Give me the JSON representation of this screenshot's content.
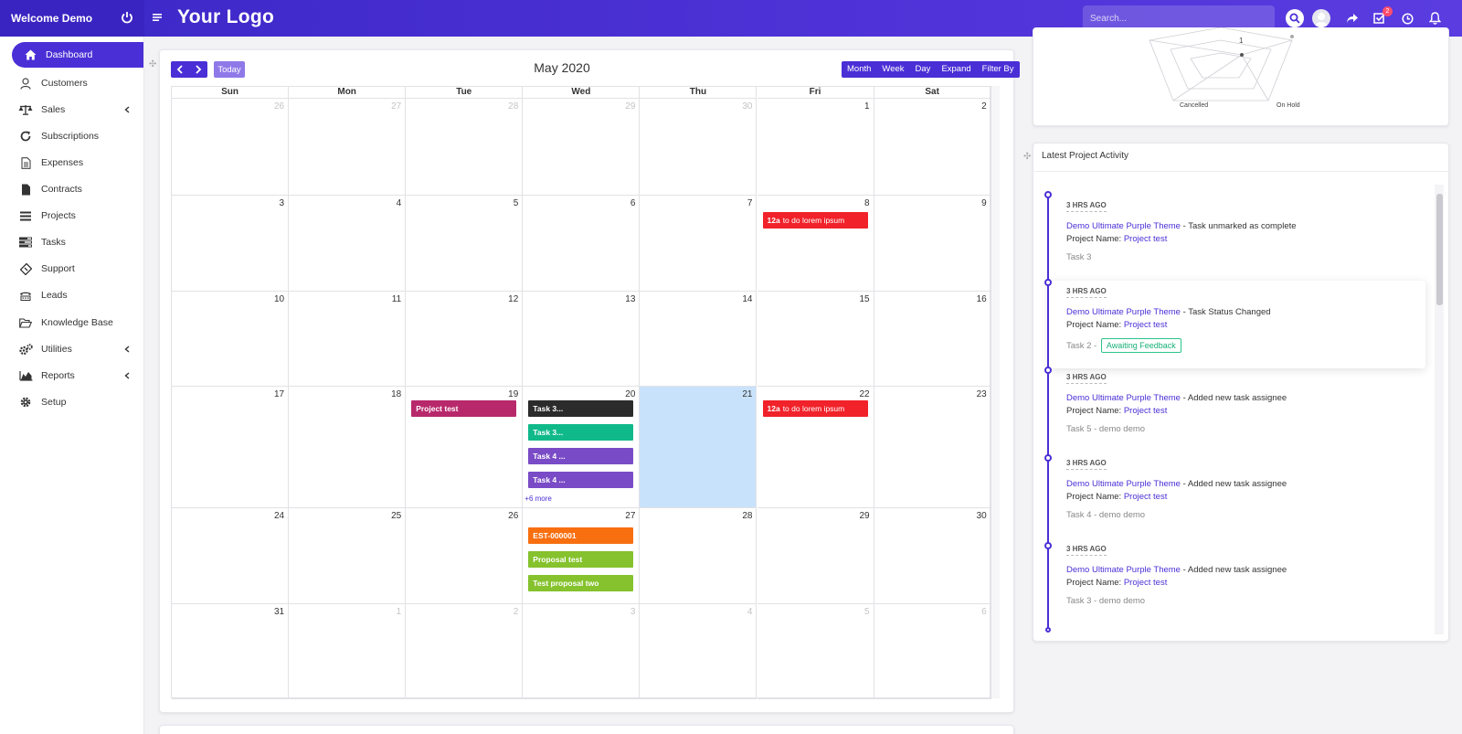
{
  "header": {
    "welcome": "Welcome Demo",
    "logo": "Your Logo",
    "search_placeholder": "Search...",
    "tasks_badge": "2"
  },
  "sidebar": {
    "items": [
      {
        "label": "Dashboard",
        "icon": "home-icon"
      },
      {
        "label": "Customers",
        "icon": "user-icon"
      },
      {
        "label": "Sales",
        "icon": "balance-scale-icon"
      },
      {
        "label": "Subscriptions",
        "icon": "refresh-icon"
      },
      {
        "label": "Expenses",
        "icon": "file-text-icon"
      },
      {
        "label": "Contracts",
        "icon": "file-icon"
      },
      {
        "label": "Projects",
        "icon": "bars-icon"
      },
      {
        "label": "Tasks",
        "icon": "tasks-icon"
      },
      {
        "label": "Support",
        "icon": "ticket-icon"
      },
      {
        "label": "Leads",
        "icon": "tty-icon"
      },
      {
        "label": "Knowledge Base",
        "icon": "folder-open-icon"
      },
      {
        "label": "Utilities",
        "icon": "cogs-icon"
      },
      {
        "label": "Reports",
        "icon": "area-chart-icon"
      },
      {
        "label": "Setup",
        "icon": "gear-icon"
      }
    ]
  },
  "calendar": {
    "title": "May 2020",
    "today_label": "Today",
    "views": [
      "Month",
      "Week",
      "Day",
      "Expand",
      "Filter By"
    ],
    "weekdays": [
      "Sun",
      "Mon",
      "Tue",
      "Wed",
      "Thu",
      "Fri",
      "Sat"
    ],
    "weeks": [
      [
        "26",
        "27",
        "28",
        "29",
        "30",
        "1",
        "2"
      ],
      [
        "3",
        "4",
        "5",
        "6",
        "7",
        "8",
        "9"
      ],
      [
        "10",
        "11",
        "12",
        "13",
        "14",
        "15",
        "16"
      ],
      [
        "17",
        "18",
        "19",
        "20",
        "21",
        "22",
        "23"
      ],
      [
        "24",
        "25",
        "26",
        "27",
        "28",
        "29",
        "30"
      ],
      [
        "31",
        "1",
        "2",
        "3",
        "4",
        "5",
        "6"
      ]
    ],
    "events": {
      "todo_time": "12a",
      "todo_title": "to do lorem ipsum",
      "project_test": "Project test",
      "task3a": "Task 3...",
      "task3b": "Task 3...",
      "task4a": "Task 4 ...",
      "task4b": "Task 4 ...",
      "more": "+6 more",
      "est": "EST-000001",
      "proposal": "Proposal test",
      "proposal_two": "Test proposal two"
    },
    "colors": {
      "red": "#f1222a",
      "magenta": "#b8296c",
      "dark": "#2b2b2b",
      "green": "#10b98a",
      "purple": "#7a4bc6",
      "orange": "#f86f10",
      "lime": "#85c22d"
    }
  },
  "radar": {
    "labels": [
      "1",
      "Cancelled",
      "On Hold"
    ]
  },
  "activity": {
    "title": "Latest Project Activity",
    "items": [
      {
        "time": "3 HRS AGO",
        "who": "Demo Ultimate Purple Theme",
        "action": "Task unmarked as complete",
        "project_label": "Project Name:",
        "project": "Project test",
        "task": "Task 3",
        "status": ""
      },
      {
        "time": "3 HRS AGO",
        "who": "Demo Ultimate Purple Theme",
        "action": "Task Status Changed",
        "project_label": "Project Name:",
        "project": "Project test",
        "task": "Task 2 -",
        "status": "Awaiting Feedback"
      },
      {
        "time": "3 HRS AGO",
        "who": "Demo Ultimate Purple Theme",
        "action": "Added new task assignee",
        "project_label": "Project Name:",
        "project": "Project test",
        "task": "Task 5 - demo demo",
        "status": ""
      },
      {
        "time": "3 HRS AGO",
        "who": "Demo Ultimate Purple Theme",
        "action": "Added new task assignee",
        "project_label": "Project Name:",
        "project": "Project test",
        "task": "Task 4 - demo demo",
        "status": ""
      },
      {
        "time": "3 HRS AGO",
        "who": "Demo Ultimate Purple Theme",
        "action": "Added new task assignee",
        "project_label": "Project Name:",
        "project": "Project test",
        "task": "Task 3 - demo demo",
        "status": ""
      }
    ]
  }
}
